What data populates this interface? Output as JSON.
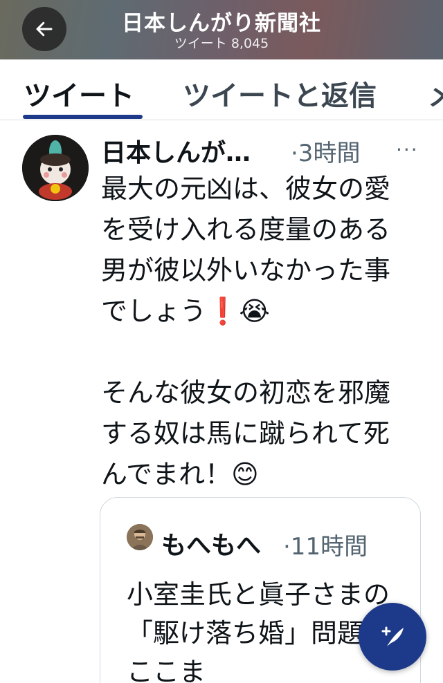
{
  "header": {
    "title": "日本しんがり新聞社",
    "subtitle": "ツイート 8,045",
    "back_icon": "arrow-left-icon"
  },
  "tabs": [
    {
      "label": "ツイート",
      "active": true
    },
    {
      "label": "ツイートと返信",
      "active": false
    },
    {
      "label": "メ",
      "active": false
    }
  ],
  "tweet": {
    "author_name": "日本しんが…",
    "meta": "·3時間",
    "more_icon": "···",
    "body": "最大の元凶は、彼女の愛を受け入れる度量のある男が彼以外いなかった事でしょう❗😭\n\nそんな彼女の初恋を邪魔する奴は馬に蹴られて死んでまれ！😊"
  },
  "quote": {
    "author_name": "もへもへ",
    "meta": "·11時間",
    "body": "小室圭氏と眞子さまの「駆け落ち婚」問題をここま"
  },
  "fab": {
    "icon": "compose-tweet-icon"
  },
  "colors": {
    "accent": "#1d3a8a",
    "secondary_text": "#536471",
    "primary_text": "#0f1419"
  }
}
